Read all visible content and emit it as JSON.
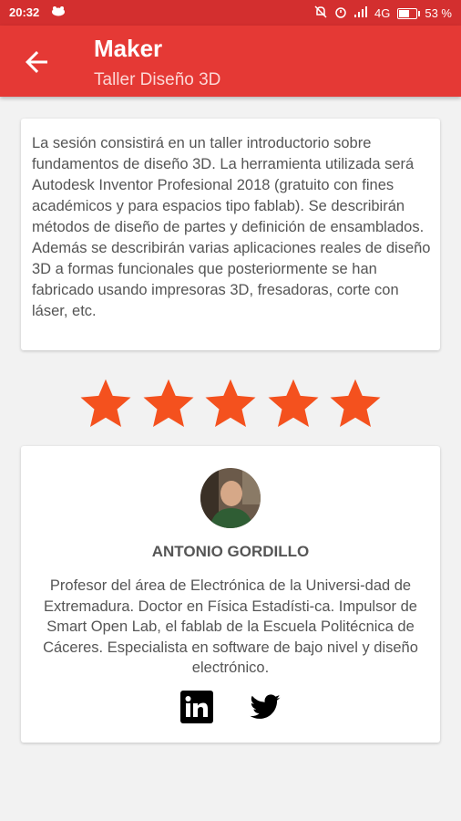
{
  "status": {
    "time": "20:32",
    "network": "4G",
    "battery": "53 %",
    "battery_level": 0.53
  },
  "appbar": {
    "title": "Maker",
    "subtitle": "Taller Diseño 3D"
  },
  "description": {
    "text": "La sesión consistirá en un taller introductorio sobre fundamentos de diseño 3D. La herramienta utilizada será Autodesk Inventor Profesional 2018 (gratuito con fines académicos y para espacios tipo fablab). Se describirán métodos de diseño de partes y definición de ensamblados. Además se describirán varias aplicaciones reales de diseño 3D a formas funcionales que posteriormente se han fabricado usando impresoras 3D, fresadoras, corte con láser, etc."
  },
  "rating": {
    "value": 5,
    "max": 5,
    "color": "#f4511e"
  },
  "author": {
    "name": "ANTONIO GORDILLO",
    "bio": "Profesor del área de Electrónica de la Universi-dad de Extremadura. Doctor en Física Estadísti-ca. Impulsor de Smart Open Lab, el fablab de la Escuela Politécnica de Cáceres. Especialista en software de bajo nivel y diseño electrónico.",
    "social": [
      "linkedin-icon",
      "twitter-icon"
    ]
  },
  "colors": {
    "primary": "#e53935",
    "status_bar": "#d32f2f"
  }
}
